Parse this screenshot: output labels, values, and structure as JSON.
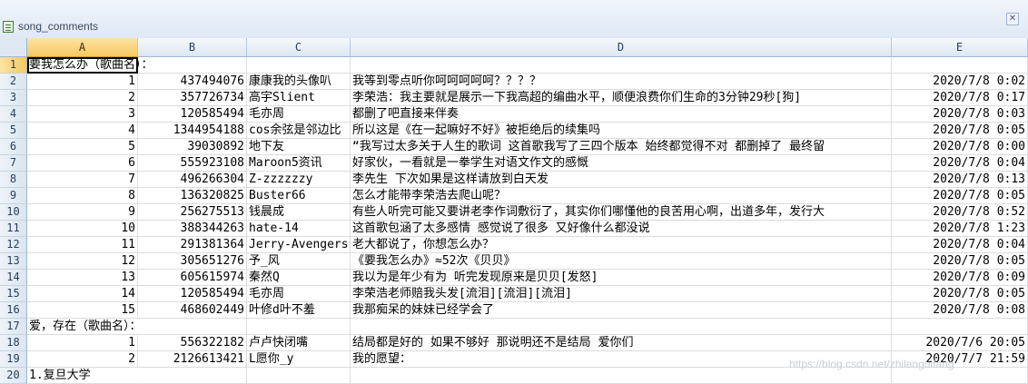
{
  "window": {
    "title": "song_comments"
  },
  "columns": [
    "A",
    "B",
    "C",
    "D",
    "E"
  ],
  "rows": [
    {
      "num": "1",
      "a": "要我怎么办（歌曲名）：",
      "b": "",
      "c": "",
      "d": "",
      "e": ""
    },
    {
      "num": "2",
      "a": "1",
      "b": "437494076",
      "c": "康康我的头像叭",
      "d": "我等到零点听你呵呵呵呵呵？？？？",
      "e": "2020/7/8 0:02"
    },
    {
      "num": "3",
      "a": "2",
      "b": "357726734",
      "c": "高宇Slient",
      "d": "李荣浩：我主要就是展示一下我高超的编曲水平，顺便浪费你们生命的3分钟29秒[狗]",
      "e": "2020/7/8 0:17"
    },
    {
      "num": "4",
      "a": "3",
      "b": "120585494",
      "c": "毛亦周",
      "d": "都删了吧直接来伴奏",
      "e": "2020/7/8 0:03"
    },
    {
      "num": "5",
      "a": "4",
      "b": "1344954188",
      "c": "cos余弦是邻边比",
      "d": "所以这是《在一起嘛好不好》被拒绝后的续集吗",
      "e": "2020/7/8 0:05"
    },
    {
      "num": "6",
      "a": "5",
      "b": "39030892",
      "c": "地下友",
      "d": "“我写过太多关于人生的歌词 这首歌我写了三四个版本 始终都觉得不对 都删掉了 最终留",
      "e": "2020/7/8 0:00"
    },
    {
      "num": "7",
      "a": "6",
      "b": "555923108",
      "c": "Maroon5资讯",
      "d": "好家伙，一看就是一拳学生对语文作文的感慨",
      "e": "2020/7/8 0:04"
    },
    {
      "num": "8",
      "a": "7",
      "b": "496266304",
      "c": "Z-zzzzzzy",
      "d": "李先生 下次如果是这样请放到白天发",
      "e": "2020/7/8 0:13"
    },
    {
      "num": "9",
      "a": "8",
      "b": "136320825",
      "c": "Buster66",
      "d": "怎么才能带李荣浩去爬山呢？",
      "e": "2020/7/8 0:05"
    },
    {
      "num": "10",
      "a": "9",
      "b": "256275513",
      "c": "钱晨成",
      "d": "有些人听完可能又要讲老李作词敷衍了，其实你们哪懂他的良苦用心啊，出道多年，发行大",
      "e": "2020/7/8 0:52"
    },
    {
      "num": "11",
      "a": "10",
      "b": "388344263",
      "c": "hate-14",
      "d": "这首歌包涵了太多感情 感觉说了很多 又好像什么都没说",
      "e": "2020/7/8 1:23"
    },
    {
      "num": "12",
      "a": "11",
      "b": "291381364",
      "c": "Jerry-Avengers",
      "d": "老大都说了，你想怎么办？",
      "e": "2020/7/8 0:04"
    },
    {
      "num": "13",
      "a": "12",
      "b": "305651276",
      "c": "予_风",
      "d": "《要我怎么办》≈52次《贝贝》",
      "e": "2020/7/8 0:05"
    },
    {
      "num": "14",
      "a": "13",
      "b": "605615974",
      "c": "秦然Q",
      "d": "我以为是年少有为 听完发现原来是贝贝[发怒]",
      "e": "2020/7/8 0:09"
    },
    {
      "num": "15",
      "a": "14",
      "b": "120585494",
      "c": "毛亦周",
      "d": "李荣浩老师赔我头发[流泪][流泪][流泪]",
      "e": "2020/7/8 0:05"
    },
    {
      "num": "16",
      "a": "15",
      "b": "468602449",
      "c": "叶修d叶不羞",
      "d": "我那痴呆的妹妹已经学会了",
      "e": "2020/7/8 0:08"
    },
    {
      "num": "17",
      "a": "爱，存在（歌曲名）：",
      "b": "",
      "c": "",
      "d": "",
      "e": ""
    },
    {
      "num": "18",
      "a": "1",
      "b": "556322182",
      "c": "卢卢快闭嘴",
      "d": "结局都是好的 如果不够好 那说明还不是结局 爱你们",
      "e": "2020/7/6 20:05"
    },
    {
      "num": "19",
      "a": "2",
      "b": "2126613421",
      "c": "L愿你_y",
      "d": "我的愿望：",
      "e": "2020/7/7 21:59"
    },
    {
      "num": "20",
      "a": "1.复旦大学",
      "b": "",
      "c": "",
      "d": "",
      "e": ""
    }
  ],
  "watermark": "https://blog.csdn.net/zhilanguifang"
}
